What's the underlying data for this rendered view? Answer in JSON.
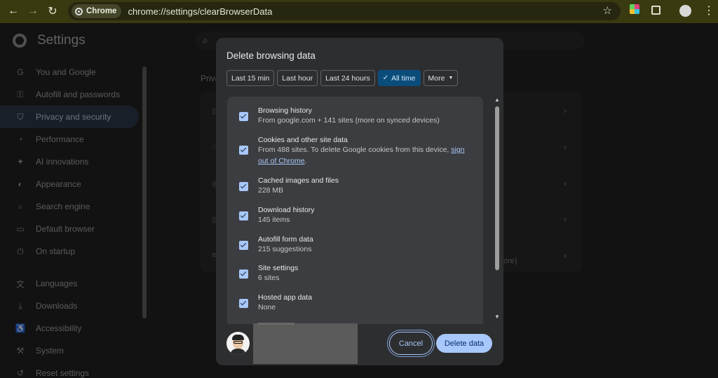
{
  "browser": {
    "chip_label": "Chrome",
    "url": "chrome://settings/clearBrowserData"
  },
  "settings": {
    "title": "Settings",
    "section_label": "Priva",
    "partial_text": "ore)",
    "sidebar": [
      {
        "label": "You and Google",
        "icon": "google-g-icon",
        "glyph": "G"
      },
      {
        "label": "Autofill and passwords",
        "icon": "key-icon",
        "glyph": "⚿"
      },
      {
        "label": "Privacy and security",
        "icon": "shield-icon",
        "glyph": "⛉",
        "active": true
      },
      {
        "label": "Performance",
        "icon": "speedometer-icon",
        "glyph": "◔"
      },
      {
        "label": "AI innovations",
        "icon": "sparkle-icon",
        "glyph": "✦"
      },
      {
        "label": "Appearance",
        "icon": "palette-icon",
        "glyph": "◐"
      },
      {
        "label": "Search engine",
        "icon": "search-icon",
        "glyph": "⌕"
      },
      {
        "label": "Default browser",
        "icon": "browser-icon",
        "glyph": "▭"
      },
      {
        "label": "On startup",
        "icon": "power-icon",
        "glyph": "⏻"
      },
      {
        "label": "Languages",
        "icon": "translate-icon",
        "glyph": "文"
      },
      {
        "label": "Downloads",
        "icon": "download-icon",
        "glyph": "⤓"
      },
      {
        "label": "Accessibility",
        "icon": "accessibility-icon",
        "glyph": "♿"
      },
      {
        "label": "System",
        "icon": "wrench-icon",
        "glyph": "⚒"
      },
      {
        "label": "Reset settings",
        "icon": "reset-icon",
        "glyph": "↺"
      }
    ]
  },
  "dialog": {
    "title": "Delete browsing data",
    "time_ranges": [
      {
        "label": "Last 15 min",
        "selected": false
      },
      {
        "label": "Last hour",
        "selected": false
      },
      {
        "label": "Last 24 hours",
        "selected": false
      },
      {
        "label": "All time",
        "selected": true
      },
      {
        "label": "More",
        "selected": false
      }
    ],
    "options": [
      {
        "title": "Browsing history",
        "desc": "From google.com + 141 sites (more on synced devices)",
        "checked": true
      },
      {
        "title": "Cookies and other site data",
        "desc": "From 488 sites. To delete Google cookies from this device, ",
        "link": "sign out of Chrome",
        "desc_end": ".",
        "checked": true
      },
      {
        "title": "Cached images and files",
        "desc": "228 MB",
        "checked": true
      },
      {
        "title": "Download history",
        "desc": "145 items",
        "checked": true
      },
      {
        "title": "Autofill form data",
        "desc": "215 suggestions",
        "checked": true
      },
      {
        "title": "Site settings",
        "desc": "6 sites",
        "checked": true
      },
      {
        "title": "Hosted app data",
        "desc": "None",
        "checked": true
      }
    ],
    "cancel_label": "Cancel",
    "delete_label": "Delete data"
  },
  "colors": {
    "accent": "#a8c7fa",
    "selected_range": "#0b4d7a",
    "toolbar": "#3a3a10"
  }
}
